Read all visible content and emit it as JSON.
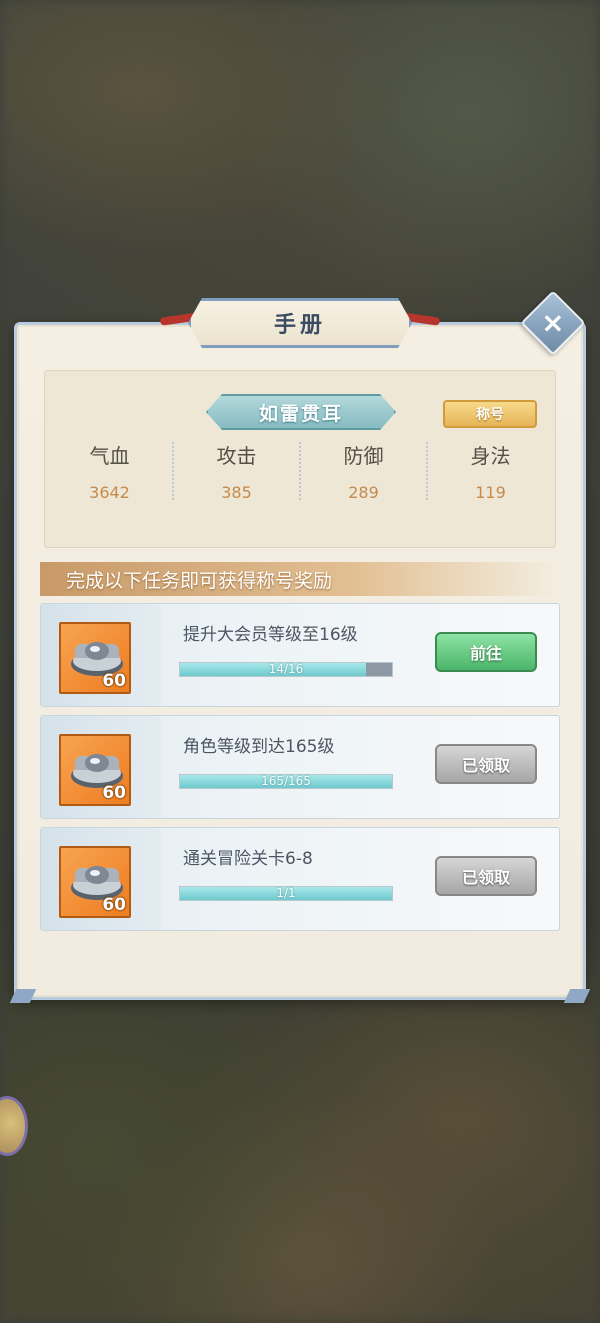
{
  "dialog": {
    "title": "手册",
    "close_label": "×"
  },
  "profile": {
    "name": "如雷贯耳",
    "badge_label": "称号",
    "stats": [
      {
        "label": "气血",
        "value": "3642"
      },
      {
        "label": "攻击",
        "value": "385"
      },
      {
        "label": "防御",
        "value": "289"
      },
      {
        "label": "身法",
        "value": "119"
      }
    ]
  },
  "banner": {
    "text": "完成以下任务即可获得称号奖励"
  },
  "tasks": [
    {
      "title": "提升大会员等级至16级",
      "progress_text": "14/16",
      "progress": 0.875,
      "reward_icon": "silver-ingot-icon",
      "reward_count": "60",
      "button_label": "前往",
      "button_state": "go"
    },
    {
      "title": "角色等级到达165级",
      "progress_text": "165/165",
      "progress": 1.0,
      "reward_icon": "silver-ingot-icon",
      "reward_count": "60",
      "button_label": "已领取",
      "button_state": "claimed"
    },
    {
      "title": "通关冒险关卡6-8",
      "progress_text": "1/1",
      "progress": 1.0,
      "reward_icon": "silver-ingot-icon",
      "reward_count": "60",
      "button_label": "已领取",
      "button_state": "claimed"
    }
  ],
  "colors": {
    "accent_green": "#4cb56a",
    "claimed_gray": "#a6a6a6",
    "stat_value": "#c58a4c",
    "reward_orange": "#ee7d22"
  }
}
